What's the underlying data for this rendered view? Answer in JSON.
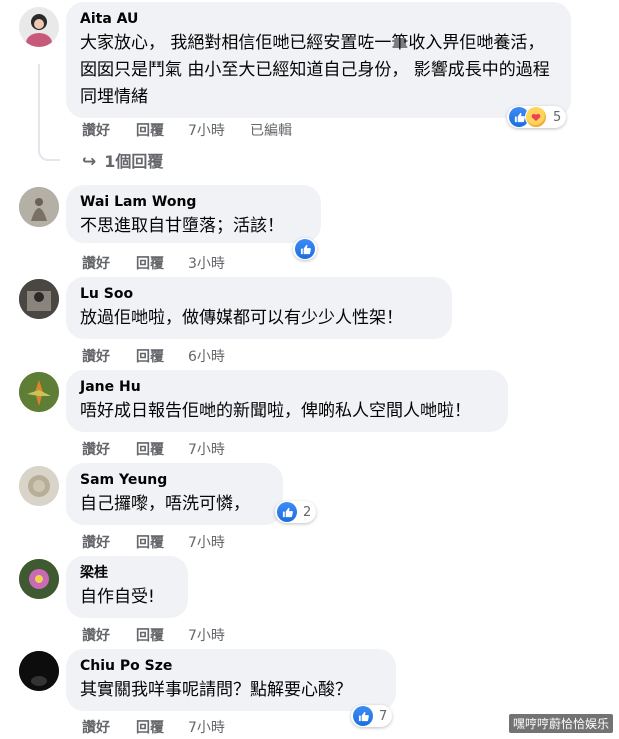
{
  "comments": [
    {
      "name": "Aita AU",
      "text": "大家放心， 我絕對相信佢哋已經安置咗一筆收入畀佢哋養活， 囡囡只是鬥氣 由小至大已經知道自己身份， 影響成長中的過程同埋情緒",
      "like": "讚好",
      "reply": "回覆",
      "time": "7小時",
      "edited": "已編輯",
      "reactions": "5",
      "reaction_icons": [
        "like-icon",
        "care-icon"
      ]
    },
    {
      "name": "Wai Lam Wong",
      "text": "不思進取自甘墮落；活該！",
      "like": "讚好",
      "reply": "回覆",
      "time": "3小時",
      "reaction_icons": [
        "like-icon"
      ]
    },
    {
      "name": "Lu Soo",
      "text": "放過佢哋啦，做傳媒都可以有少少人性架！",
      "like": "讚好",
      "reply": "回覆",
      "time": "6小時"
    },
    {
      "name": "Jane Hu",
      "text": "唔好成日報告佢哋的新聞啦，俾啲私人空間人哋啦！",
      "like": "讚好",
      "reply": "回覆",
      "time": "7小時"
    },
    {
      "name": "Sam Yeung",
      "text": "自己攞嚟，唔洗可憐，",
      "like": "讚好",
      "reply": "回覆",
      "time": "7小時",
      "reactions": "2",
      "reaction_icons": [
        "like-icon"
      ]
    },
    {
      "name": "梁桂",
      "text": "自作自受!",
      "like": "讚好",
      "reply": "回覆",
      "time": "7小時"
    },
    {
      "name": "Chiu Po Sze",
      "text": "其實關我咩事呢請問？點解要心酸？",
      "like": "讚好",
      "reply": "回覆",
      "time": "7小時",
      "reactions": "7",
      "reaction_icons": [
        "like-icon"
      ]
    }
  ],
  "replies_link": "1個回覆",
  "watermark": "嘿哼哼蔚恰恰娱乐"
}
